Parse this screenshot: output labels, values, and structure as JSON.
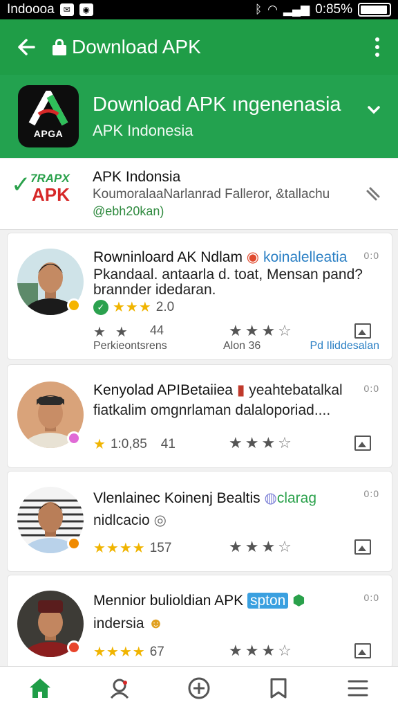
{
  "status_bar": {
    "carrier": "Indoooa",
    "time": "0:85%"
  },
  "app_bar": {
    "title": "Download APK"
  },
  "app_header": {
    "logo_text": "APGA",
    "title": "Download APK ıngenenasia",
    "subtitle": "APK Indonesia"
  },
  "publisher": {
    "logo_top": "7RAPX",
    "logo_main": "APK",
    "name": "APK Indonsia",
    "description": "KoumoralaaNarlanrad Falleror, &tallachu",
    "handle": "@ebh20kan)"
  },
  "cards": [
    {
      "title": "Rowninloard AK Ndlam",
      "tag": "koinalelleatia",
      "line1": "Pkandaal. antaarla d. toat, Mensan pand?",
      "line2": "brannder idedaran.",
      "rating": "2.0",
      "stat_left": "44",
      "stat_right": "",
      "footer_left": "Perkieontsrens",
      "footer_mid": "Alon 36",
      "footer_right": "Pd Iliddesalan"
    },
    {
      "title": "Kenyolad APIBetaiiea",
      "tag": "yeahtebatalkal",
      "line1": "fiatkalim omgnrlaman dalaloporiad....",
      "rating_left": "1:0,85",
      "rating_right": "41"
    },
    {
      "title": "Vlenlainec Koinenj Bealtis",
      "tag": "clarag",
      "line1": "nidlcacio",
      "rating": "157"
    },
    {
      "title": "Mennior bulioldian APK",
      "tag": "spton",
      "line1": "indersia",
      "rating": "67"
    }
  ],
  "card_menu": "0:0",
  "colors": {
    "primary_green": "#1f9d47",
    "header_green": "#23a24f",
    "accent_gold": "#f0b400",
    "brand_red": "#d62828"
  },
  "icons": {
    "app_bar": [
      "back-arrow-icon",
      "lock-icon",
      "more-vert-icon"
    ],
    "nav": [
      "home-icon",
      "profile-icon",
      "add-circle-icon",
      "bookmark-icon",
      "menu-icon"
    ]
  }
}
